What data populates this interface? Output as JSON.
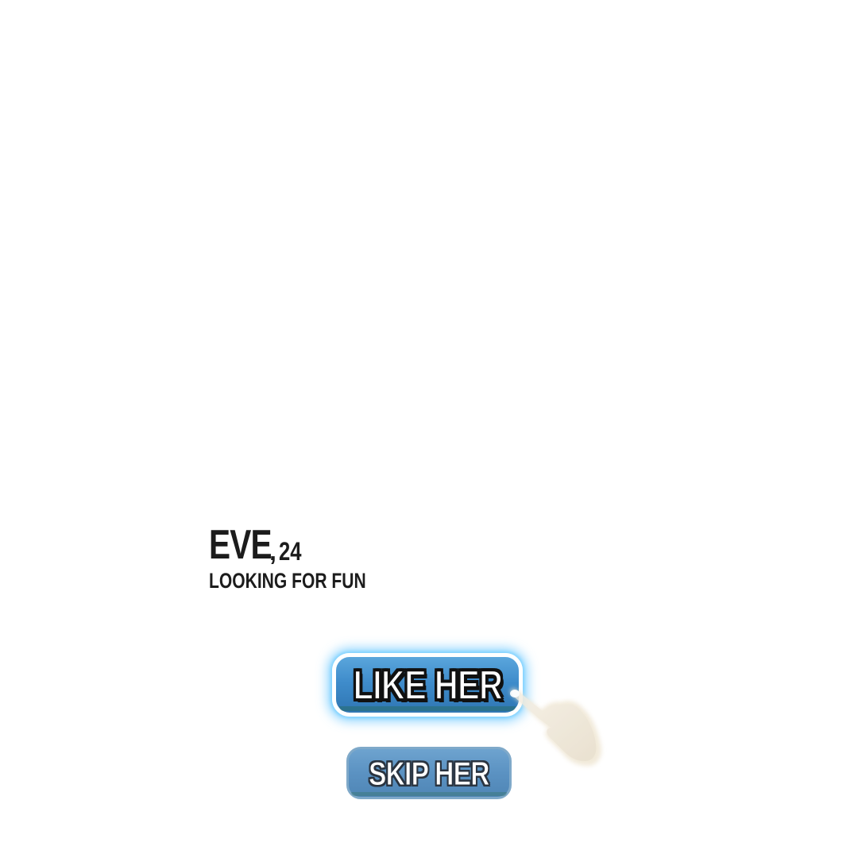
{
  "profile": {
    "name": "EVE",
    "separator": ",",
    "age": "24",
    "tagline": "LOOKING FOR FUN"
  },
  "actions": {
    "like_label": "LIKE HER",
    "skip_label": "SKIP HER"
  },
  "icons": {
    "pointer": "pointing-hand-icon"
  },
  "colors": {
    "text": "#1c1c1c",
    "like_button": "#3f8ccb",
    "like_glow": "#6ec8ff",
    "skip_button": "#5b92c2",
    "hand": "#ece3d2"
  }
}
